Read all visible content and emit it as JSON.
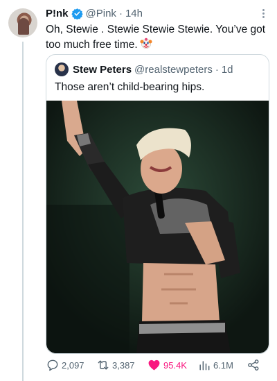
{
  "tweet": {
    "author_name": "P!nk",
    "author_handle": "@Pink",
    "separator": "·",
    "timestamp": "14h",
    "text": "Oh, Stewie . Stewie Stewie Stewie. You’ve got too much free time.",
    "emoji": "clown-face"
  },
  "quote": {
    "author_name": "Stew Peters",
    "author_handle": "@realstewpeters",
    "separator": "·",
    "timestamp": "1d",
    "text": "Those aren’t child-bearing hips.",
    "image": "concert-photo"
  },
  "stats": {
    "replies": "2,097",
    "retweets": "3,387",
    "likes": "95.4K",
    "views": "6.1M"
  },
  "colors": {
    "verified": "#1d9bf0",
    "like": "#f91880",
    "muted": "#536471",
    "border": "#cfd9de"
  }
}
